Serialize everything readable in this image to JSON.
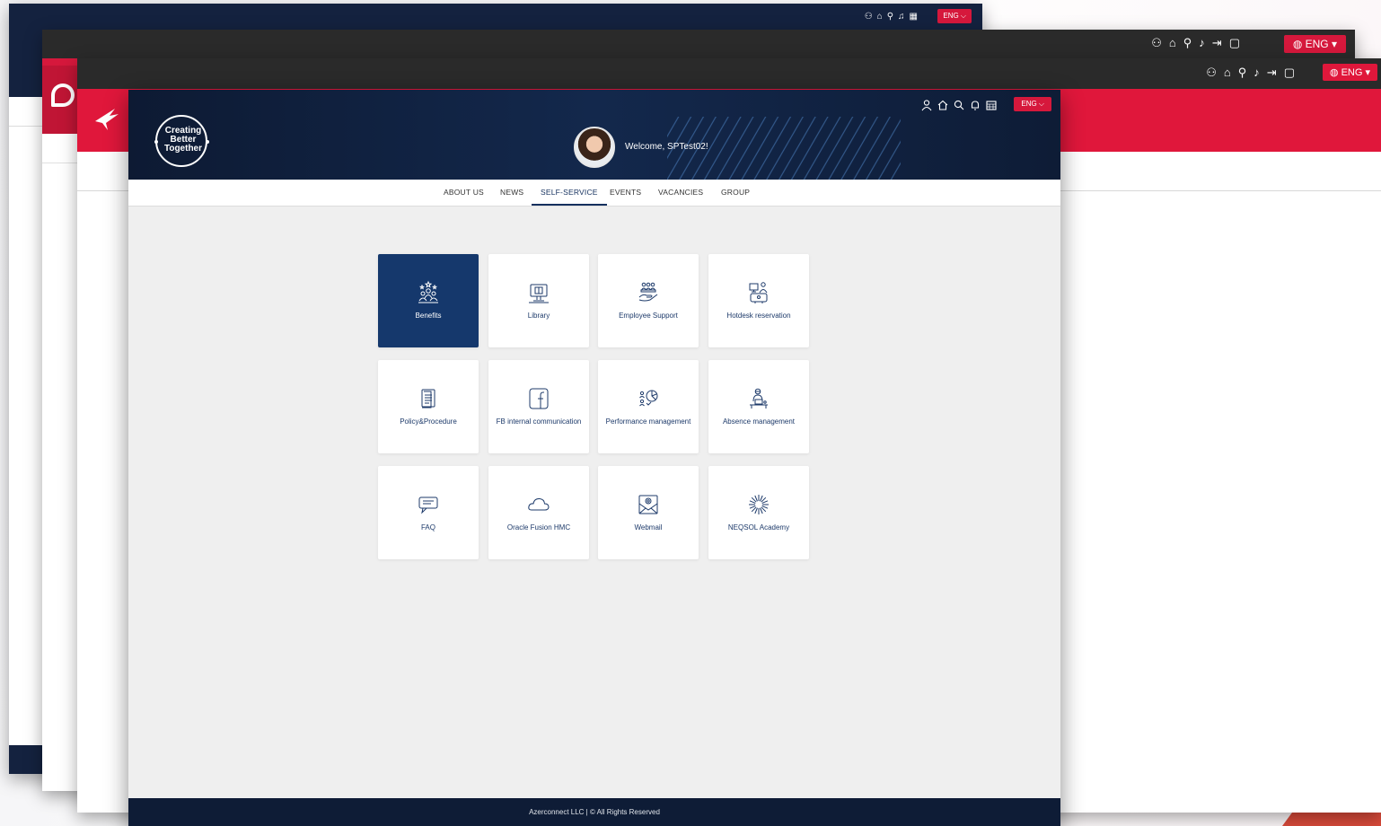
{
  "background_windows": {
    "back": {
      "lang": "ENG"
    },
    "middle": {
      "lang": "ENG"
    },
    "front": {
      "lang": "ENG"
    }
  },
  "header": {
    "brand_lines": [
      "Creating",
      "Better",
      "Together"
    ],
    "welcome": "Welcome, SPTest02!",
    "lang": "ENG",
    "icons": [
      "user-icon",
      "home-icon",
      "search-icon",
      "bell-icon",
      "calendar-icon"
    ]
  },
  "nav": {
    "items": [
      {
        "label": "ABOUT US"
      },
      {
        "label": "NEWS"
      },
      {
        "label": "SELF-SERVICE",
        "active": true
      },
      {
        "label": "EVENTS"
      },
      {
        "label": "VACANCIES"
      },
      {
        "label": "GROUP"
      }
    ]
  },
  "tiles": [
    {
      "label": "Benefits",
      "icon": "benefits-people-stars-icon",
      "active": true
    },
    {
      "label": "Library",
      "icon": "library-computer-icon"
    },
    {
      "label": "Employee Support",
      "icon": "employee-support-hand-icon"
    },
    {
      "label": "Hotdesk reservation",
      "icon": "hotdesk-person-desk-icon"
    },
    {
      "label": "Policy&Procedure",
      "icon": "document-icon"
    },
    {
      "label": "FB internal communication",
      "icon": "facebook-icon"
    },
    {
      "label": "Performance management",
      "icon": "performance-gear-people-icon"
    },
    {
      "label": "Absence management",
      "icon": "absence-person-laptop-icon"
    },
    {
      "label": "FAQ",
      "icon": "chat-bubble-icon"
    },
    {
      "label": "Oracle Fusion HMC",
      "icon": "cloud-icon"
    },
    {
      "label": "Webmail",
      "icon": "mail-icon"
    },
    {
      "label": "NEQSOL Academy",
      "icon": "academy-burst-icon"
    }
  ],
  "footer": {
    "text": "Azerconnect LLC | © All Rights Reserved"
  },
  "colors": {
    "navy": "#15386c",
    "header_dark": "#0d1a33",
    "accent_red": "#d6183c",
    "canvas": "#efefef"
  }
}
